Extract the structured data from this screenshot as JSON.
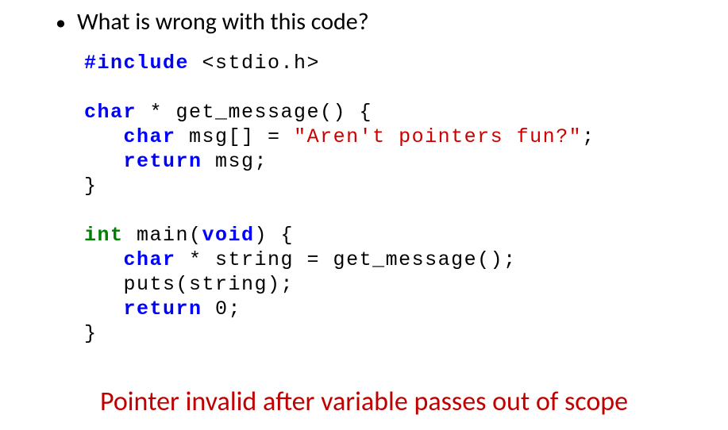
{
  "bullet": {
    "text": "What is wrong with this code?"
  },
  "code": {
    "l1a": "#include",
    "l1b": " <stdio.h>",
    "l3a": "char",
    "l3b": " * get_message() {",
    "l4a": "   ",
    "l4b": "char",
    "l4c": " msg[] = ",
    "l4d": "\"Aren't pointers fun?\"",
    "l4e": ";",
    "l5a": "   ",
    "l5b": "return",
    "l5c": " msg;",
    "l6a": "}",
    "l8a": "int",
    "l8b": " main(",
    "l8c": "void",
    "l8d": ") {",
    "l9a": "   ",
    "l9b": "char",
    "l9c": " * string = get_message();",
    "l10a": "   puts(string);",
    "l11a": "   ",
    "l11b": "return",
    "l11c": " 0;",
    "l12a": "}"
  },
  "note": "Pointer invalid after variable passes out of scope"
}
